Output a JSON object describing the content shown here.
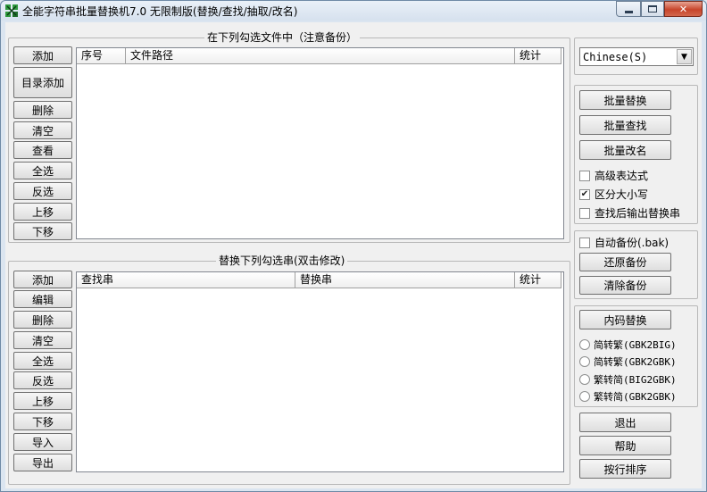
{
  "window": {
    "title": "全能字符串批量替换机7.0 无限制版(替换/查找/抽取/改名)"
  },
  "files_group": {
    "title": "在下列勾选文件中（注意备份）",
    "buttons": [
      "添加",
      "目录添加",
      "删除",
      "清空",
      "查看",
      "全选",
      "反选",
      "上移",
      "下移"
    ],
    "columns": [
      "序号",
      "文件路径",
      "统计"
    ]
  },
  "replace_group": {
    "title": "替换下列勾选串(双击修改)",
    "buttons": [
      "添加",
      "编辑",
      "删除",
      "清空",
      "全选",
      "反选",
      "上移",
      "下移",
      "导入",
      "导出"
    ],
    "columns": [
      "查找串",
      "替换串",
      "统计"
    ]
  },
  "language": {
    "selected": "Chinese(S)"
  },
  "actions": {
    "batch_replace": "批量替换",
    "batch_find": "批量查找",
    "batch_rename": "批量改名",
    "regex": {
      "label": "高级表达式",
      "checked": false
    },
    "case_sensitive": {
      "label": "区分大小写",
      "checked": true
    },
    "output_after_find": {
      "label": "查找后输出替换串",
      "checked": false
    }
  },
  "backup": {
    "auto_backup": {
      "label": "自动备份(.bak)",
      "checked": false
    },
    "restore": "还原备份",
    "clear": "清除备份"
  },
  "encoding": {
    "convert": "内码替换",
    "options": [
      "简转繁(GBK2BIG)",
      "简转繁(GBK2GBK)",
      "繁转简(BIG2GBK)",
      "繁转简(GBK2GBK)"
    ]
  },
  "footer": {
    "exit": "退出",
    "help": "帮助",
    "sort": "按行排序"
  },
  "colors": {
    "window_bg": "#dbe5f0",
    "client_bg": "#f0f0f0",
    "close_button": "#c7452b"
  },
  "icons": {
    "app": "app-icon",
    "minimize": "minimize-icon",
    "maximize": "maximize-icon",
    "close": "close-icon",
    "dropdown": "chevron-down-icon",
    "check": "checkmark-icon"
  }
}
